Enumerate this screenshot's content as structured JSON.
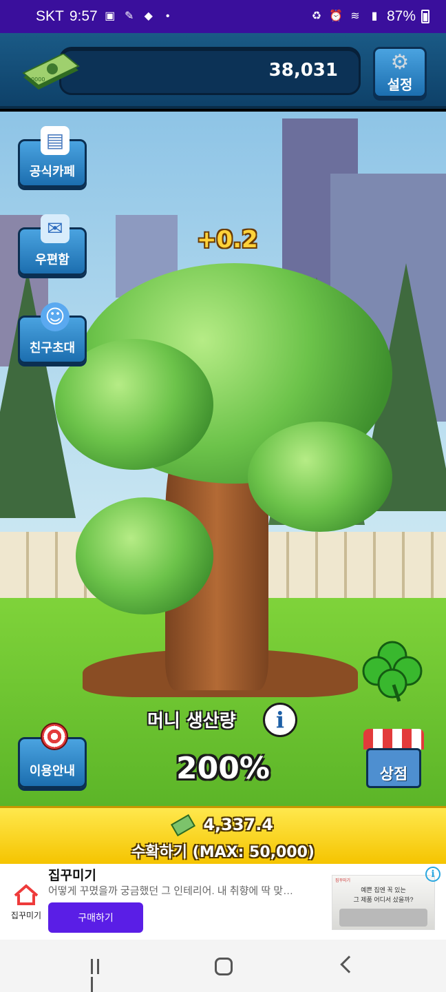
{
  "status_bar": {
    "carrier": "SKT",
    "time": "9:57",
    "battery": "87%"
  },
  "top_bar": {
    "money": "38,031",
    "settings_label": "설정"
  },
  "side_menu": {
    "cafe_label": "공식카페",
    "mailbox_label": "우편함",
    "invite_label": "친구초대",
    "guide_label": "이용안내"
  },
  "game": {
    "floating_gain": "+0.2",
    "production_label": "머니 생산량",
    "production_value": "200%",
    "shop_label": "상점"
  },
  "harvest": {
    "amount": "4,337.4",
    "button_label": "수확하기 (MAX: 50,000)"
  },
  "ad": {
    "brand": "집꾸미기",
    "title": "집꾸미기",
    "description": "어떻게 꾸몄을까 궁금했던 그 인테리어. 내 취향에 딱 맞…",
    "buy_label": "구매하기",
    "image_text_1": "예쁜 집엔 꼭 있는",
    "image_text_2": "그 제품 어디서 샀을까?",
    "image_brand": "집꾸미기",
    "accent_color": "#5a1ee6"
  },
  "nav_bar": {
    "recent_icon": "recent-apps-icon",
    "home_icon": "home-icon",
    "back_icon": "back-icon"
  },
  "colors": {
    "status_bar": "#3a0f9c",
    "top_bar": "#1a5a86",
    "harvest_bar": "#f5c400"
  }
}
